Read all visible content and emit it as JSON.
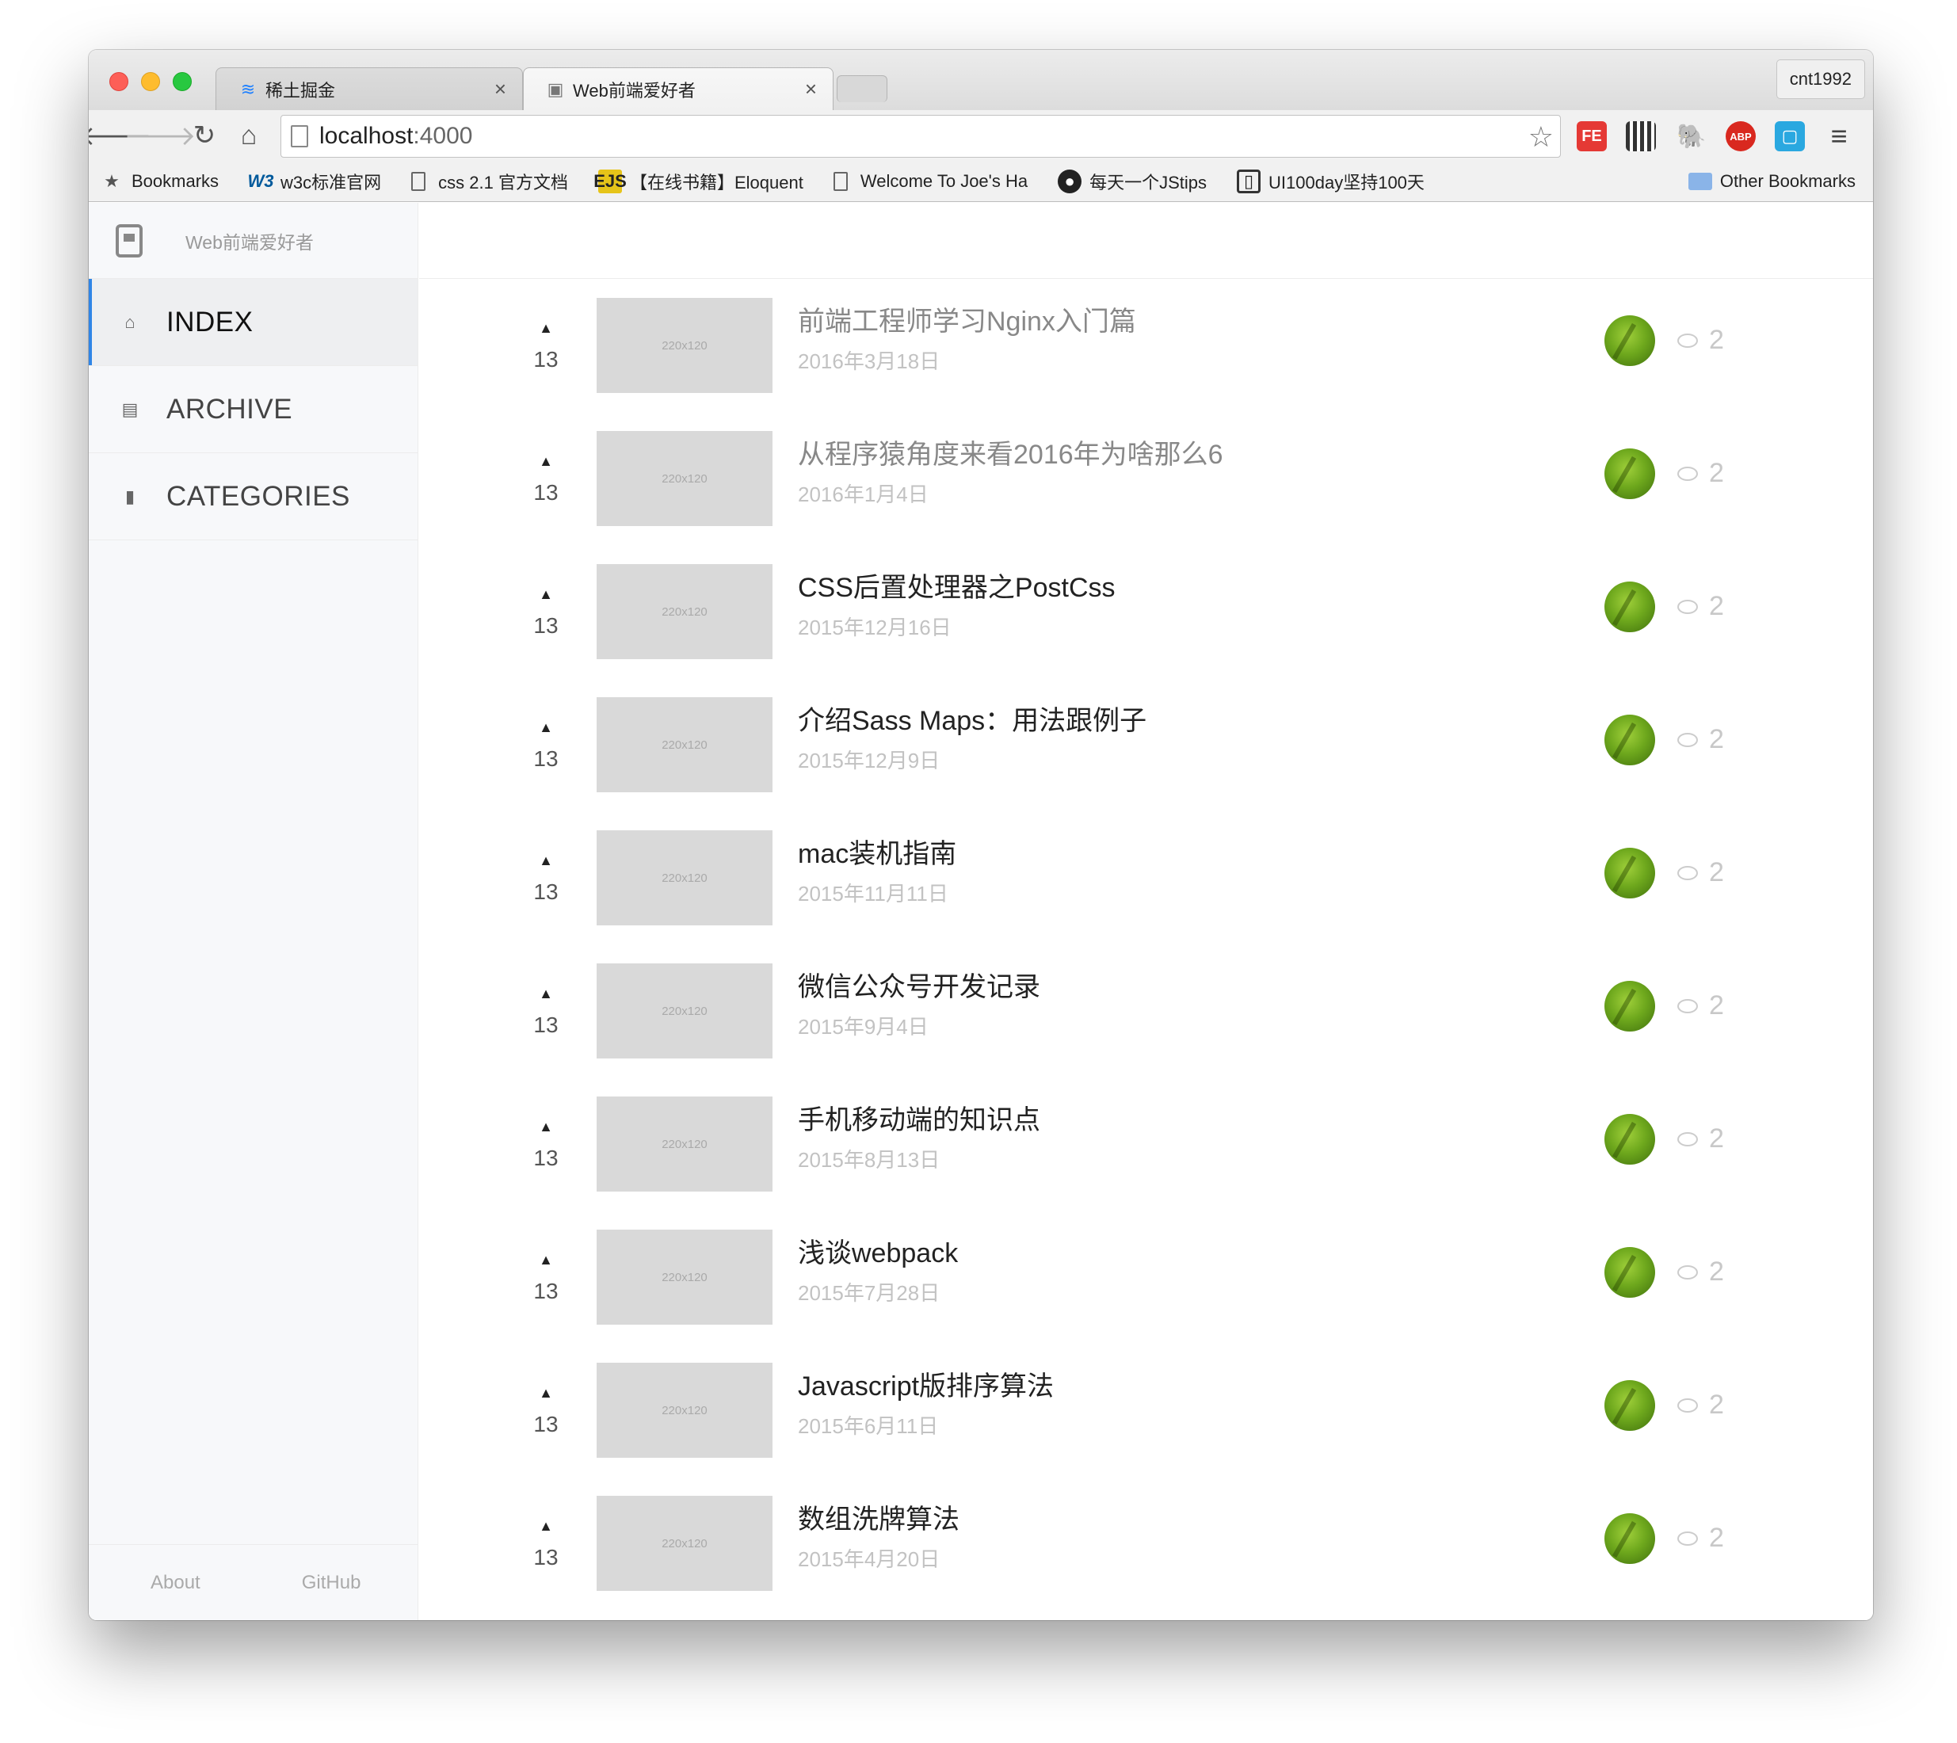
{
  "browser": {
    "tabs": [
      {
        "label": "稀土掘金",
        "icon": "juejin-icon"
      },
      {
        "label": "Web前端爱好者",
        "icon": "site-icon"
      }
    ],
    "profile": "cnt1992",
    "url_host": "localhost",
    "url_port": ":4000",
    "bookmarks": [
      {
        "label": "Bookmarks",
        "icon": "star-icon"
      },
      {
        "label": "w3c标准官网",
        "icon": "w3c-icon"
      },
      {
        "label": "css 2.1 官方文档",
        "icon": "document-icon"
      },
      {
        "label": "【在线书籍】Eloquent",
        "icon": "ejs-icon"
      },
      {
        "label": "Welcome To Joe's Ha",
        "icon": "document-icon"
      },
      {
        "label": "每天一个JStips",
        "icon": "github-icon"
      },
      {
        "label": "UI100day坚持100天",
        "icon": "ui100-icon"
      }
    ],
    "other_bookmarks": "Other Bookmarks",
    "extensions": {
      "fe": "FE",
      "abp": "ABP"
    }
  },
  "sidebar": {
    "brand": "Web前端爱好者",
    "menu": [
      {
        "label": "INDEX",
        "active": true,
        "icon": "home-icon"
      },
      {
        "label": "ARCHIVE",
        "active": false,
        "icon": "archive-icon"
      },
      {
        "label": "CATEGORIES",
        "active": false,
        "icon": "file-icon"
      }
    ],
    "footer": {
      "about": "About",
      "github": "GitHub"
    }
  },
  "posts": [
    {
      "title": "前端工程师学习Nginx入门篇",
      "date": "2016年3月18日",
      "votes": "13",
      "thumb": "220x120",
      "comments": "2",
      "visited": true
    },
    {
      "title": "从程序猿角度来看2016年为啥那么6",
      "date": "2016年1月4日",
      "votes": "13",
      "thumb": "220x120",
      "comments": "2",
      "visited": true
    },
    {
      "title": "CSS后置处理器之PostCss",
      "date": "2015年12月16日",
      "votes": "13",
      "thumb": "220x120",
      "comments": "2",
      "visited": false
    },
    {
      "title": "介绍Sass Maps：用法跟例子",
      "date": "2015年12月9日",
      "votes": "13",
      "thumb": "220x120",
      "comments": "2",
      "visited": false
    },
    {
      "title": "mac装机指南",
      "date": "2015年11月11日",
      "votes": "13",
      "thumb": "220x120",
      "comments": "2",
      "visited": false
    },
    {
      "title": "微信公众号开发记录",
      "date": "2015年9月4日",
      "votes": "13",
      "thumb": "220x120",
      "comments": "2",
      "visited": false
    },
    {
      "title": "手机移动端的知识点",
      "date": "2015年8月13日",
      "votes": "13",
      "thumb": "220x120",
      "comments": "2",
      "visited": false
    },
    {
      "title": "浅谈webpack",
      "date": "2015年7月28日",
      "votes": "13",
      "thumb": "220x120",
      "comments": "2",
      "visited": false
    },
    {
      "title": "Javascript版排序算法",
      "date": "2015年6月11日",
      "votes": "13",
      "thumb": "220x120",
      "comments": "2",
      "visited": false
    },
    {
      "title": "数组洗牌算法",
      "date": "2015年4月20日",
      "votes": "13",
      "thumb": "220x120",
      "comments": "2",
      "visited": false
    }
  ]
}
